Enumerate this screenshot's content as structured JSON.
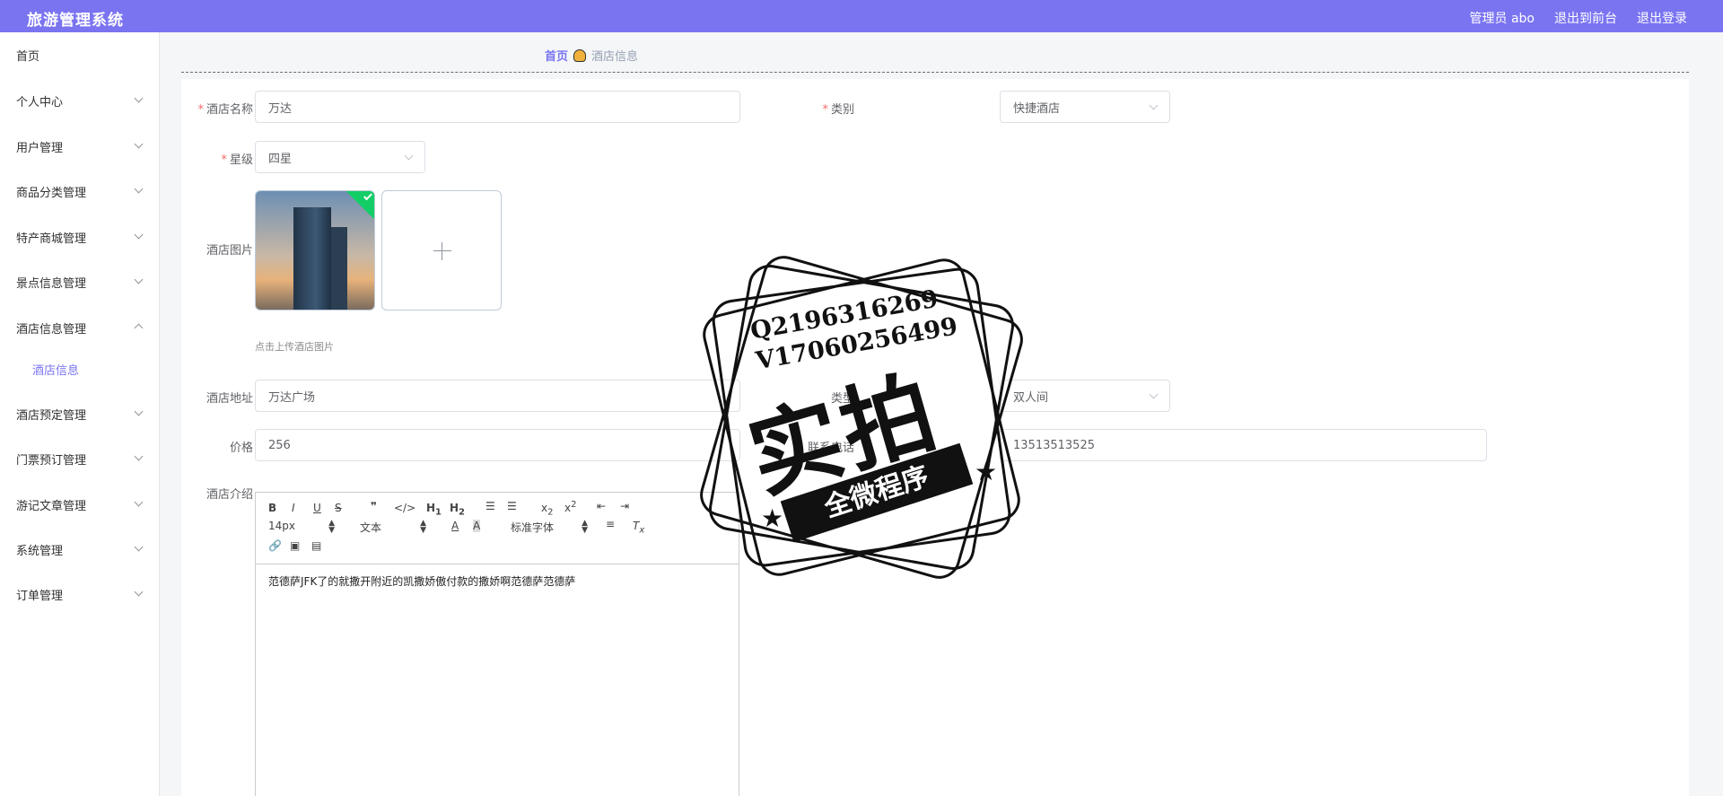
{
  "app": {
    "title": "旅游管理系统"
  },
  "topnav": {
    "user": "管理员 abo",
    "to_front": "退出到前台",
    "logout": "退出登录"
  },
  "sidebar": {
    "items": [
      {
        "label": "首页"
      },
      {
        "label": "个人中心"
      },
      {
        "label": "用户管理"
      },
      {
        "label": "商品分类管理"
      },
      {
        "label": "特产商城管理"
      },
      {
        "label": "景点信息管理"
      },
      {
        "label": "酒店信息管理"
      },
      {
        "label": "酒店预定管理"
      },
      {
        "label": "门票预订管理"
      },
      {
        "label": "游记文章管理"
      },
      {
        "label": "系统管理"
      },
      {
        "label": "订单管理"
      }
    ],
    "sub_active": "酒店信息"
  },
  "breadcrumb": {
    "home": "首页",
    "current": "酒店信息"
  },
  "form": {
    "name": {
      "label": "酒店名称",
      "value": "万达"
    },
    "category": {
      "label": "类别",
      "value": "快捷酒店"
    },
    "star": {
      "label": "星级",
      "value": "四星"
    },
    "image": {
      "label": "酒店图片",
      "tip": "点击上传酒店图片"
    },
    "address": {
      "label": "酒店地址",
      "value": "万达广场"
    },
    "room_type": {
      "label": "类型",
      "value": "双人间"
    },
    "price": {
      "label": "价格",
      "value": "256"
    },
    "phone": {
      "label": "联系电话",
      "value": "13513513525"
    },
    "intro": {
      "label": "酒店介绍",
      "content": "范德萨JFK了的就撒开附近的凯撒娇傲付款的撒娇啊范德萨范德萨"
    }
  },
  "editor": {
    "font_size": "14px",
    "block": "文本",
    "font_family": "标准字体"
  },
  "watermark": {
    "qq": "Q2196316269",
    "v": "V17060256499",
    "big": "实拍",
    "ribbon": "全微程序"
  }
}
